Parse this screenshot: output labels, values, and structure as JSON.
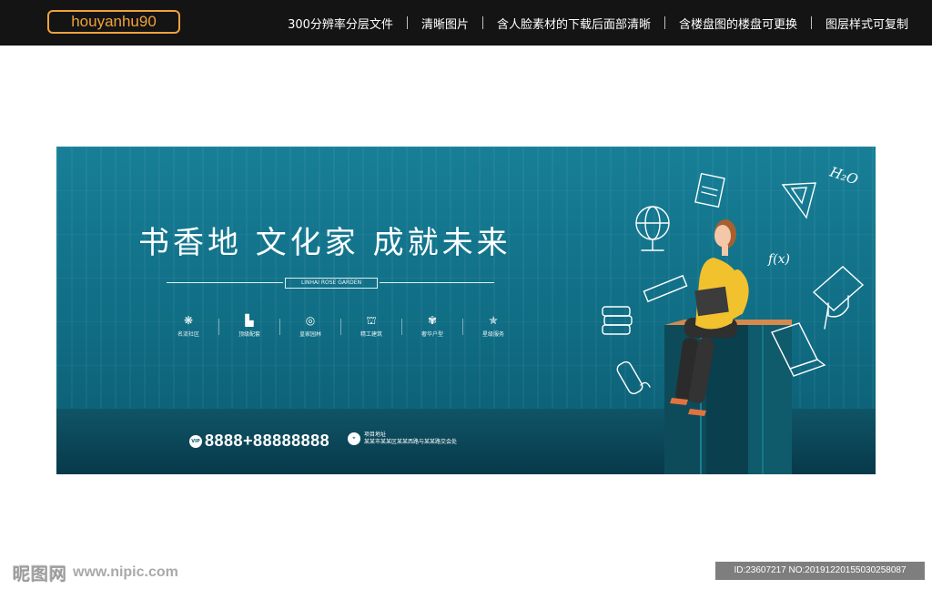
{
  "header": {
    "brand": "houyanhu90",
    "nav": [
      "300分辨率分层文件",
      "清晰图片",
      "含人脸素材的下载后面部清晰",
      "含楼盘图的楼盘可更换",
      "图层样式可复制"
    ]
  },
  "banner": {
    "headline": "书香地  文化家  成就未来",
    "subtitle": "LINHAI ROSE GARDEN",
    "features": [
      {
        "icon": "snowflake-icon",
        "label": "名流社区"
      },
      {
        "icon": "building-icon",
        "label": "顶级配套"
      },
      {
        "icon": "garden-icon",
        "label": "皇家园林"
      },
      {
        "icon": "architecture-icon",
        "label": "精工建筑"
      },
      {
        "icon": "gem-icon",
        "label": "奢华户型"
      },
      {
        "icon": "star-ring-icon",
        "label": "星级服务"
      }
    ],
    "vip_badge": "VIP",
    "phone": "8888+88888888",
    "address_title": "项目地址",
    "address": "某某市某某区某某西路与某某路交会处",
    "doodles": {
      "h2o": "H₂O",
      "fx": "f(x)"
    }
  },
  "footer": {
    "watermark_logo": "昵图网",
    "watermark_site": "www.nipic.com",
    "image_id": "ID:23607217 NO:20191220155030258087"
  },
  "colors": {
    "banner_teal": "#137a91",
    "brand_orange": "#f0a23a",
    "shirt_yellow": "#f2c12e",
    "topbar": "#141414"
  }
}
